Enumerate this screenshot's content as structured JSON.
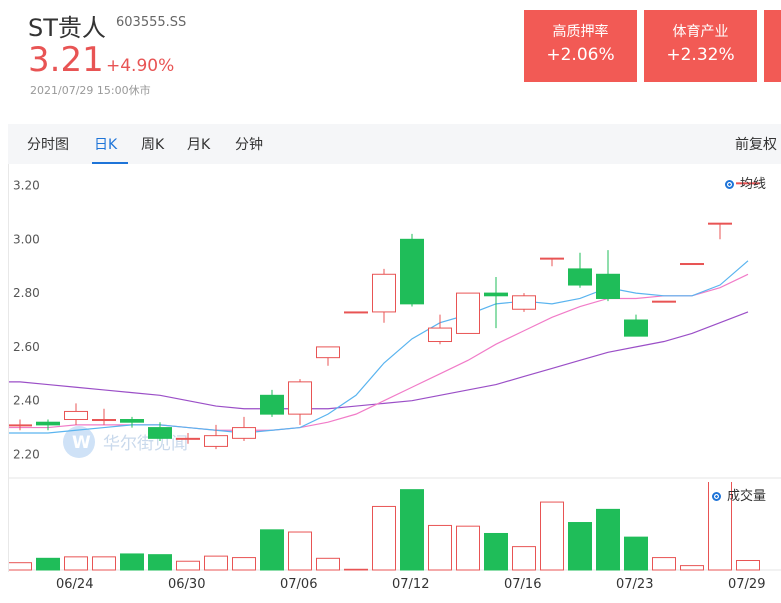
{
  "stock": {
    "name": "ST贵人",
    "code": "603555.SS",
    "price": "3.21",
    "change_pct": "+4.90%",
    "datetime": "2021/07/29 15:00休市"
  },
  "sector_cards": [
    {
      "title": "高质押率",
      "value": "+2.06%"
    },
    {
      "title": "体育产业",
      "value": "+2.32%"
    }
  ],
  "tabs": [
    {
      "label": "分时图"
    },
    {
      "label": "日K"
    },
    {
      "label": "周K"
    },
    {
      "label": "月K"
    },
    {
      "label": "分钟"
    }
  ],
  "active_tab": "日K",
  "adjust_label": "前复权",
  "legend": {
    "ma": "均线",
    "volume": "成交量"
  },
  "watermark": "华尔街见闻",
  "colors": {
    "up": "#e85454",
    "down": "#1fbd59",
    "ma5": "#5ab4ef",
    "ma10": "#f17cc8",
    "ma20": "#9b4fc7"
  },
  "chart_data": {
    "type": "candlestick",
    "y_ticks": [
      "3.20",
      "3.00",
      "2.80",
      "2.60",
      "2.40",
      "2.20"
    ],
    "ylim": [
      2.12,
      3.28
    ],
    "x_ticks": [
      {
        "index": 2,
        "label": "06/24"
      },
      {
        "index": 6,
        "label": "06/30"
      },
      {
        "index": 10,
        "label": "07/06"
      },
      {
        "index": 14,
        "label": "07/12"
      },
      {
        "index": 18,
        "label": "07/16"
      },
      {
        "index": 22,
        "label": "07/23"
      },
      {
        "index": 26,
        "label": "07/29"
      }
    ],
    "candles": [
      {
        "o": 2.31,
        "c": 2.31,
        "h": 2.33,
        "l": 2.29
      },
      {
        "o": 2.32,
        "c": 2.31,
        "h": 2.33,
        "l": 2.29
      },
      {
        "o": 2.33,
        "c": 2.36,
        "h": 2.39,
        "l": 2.31
      },
      {
        "o": 2.33,
        "c": 2.33,
        "h": 2.37,
        "l": 2.31
      },
      {
        "o": 2.33,
        "c": 2.32,
        "h": 2.34,
        "l": 2.3
      },
      {
        "o": 2.3,
        "c": 2.26,
        "h": 2.32,
        "l": 2.25
      },
      {
        "o": 2.26,
        "c": 2.26,
        "h": 2.28,
        "l": 2.24
      },
      {
        "o": 2.23,
        "c": 2.27,
        "h": 2.31,
        "l": 2.22
      },
      {
        "o": 2.26,
        "c": 2.3,
        "h": 2.34,
        "l": 2.25
      },
      {
        "o": 2.42,
        "c": 2.35,
        "h": 2.44,
        "l": 2.34
      },
      {
        "o": 2.35,
        "c": 2.47,
        "h": 2.48,
        "l": 2.31
      },
      {
        "o": 2.56,
        "c": 2.6,
        "h": 2.6,
        "l": 2.53
      },
      {
        "o": 2.73,
        "c": 2.73,
        "h": 2.73,
        "l": 2.73
      },
      {
        "o": 2.73,
        "c": 2.87,
        "h": 2.89,
        "l": 2.69
      },
      {
        "o": 3.0,
        "c": 2.76,
        "h": 3.02,
        "l": 2.75
      },
      {
        "o": 2.62,
        "c": 2.67,
        "h": 2.72,
        "l": 2.61
      },
      {
        "o": 2.65,
        "c": 2.8,
        "h": 2.8,
        "l": 2.65
      },
      {
        "o": 2.8,
        "c": 2.79,
        "h": 2.86,
        "l": 2.67
      },
      {
        "o": 2.74,
        "c": 2.79,
        "h": 2.8,
        "l": 2.73
      },
      {
        "o": 2.93,
        "c": 2.93,
        "h": 2.93,
        "l": 2.9
      },
      {
        "o": 2.89,
        "c": 2.83,
        "h": 2.95,
        "l": 2.82
      },
      {
        "o": 2.87,
        "c": 2.78,
        "h": 2.96,
        "l": 2.77
      },
      {
        "o": 2.7,
        "c": 2.64,
        "h": 2.72,
        "l": 2.64
      },
      {
        "o": 2.77,
        "c": 2.77,
        "h": 2.77,
        "l": 2.77
      },
      {
        "o": 2.91,
        "c": 2.91,
        "h": 2.91,
        "l": 2.91
      },
      {
        "o": 3.06,
        "c": 3.06,
        "h": 3.06,
        "l": 3.0
      },
      {
        "o": 3.21,
        "c": 3.21,
        "h": 3.21,
        "l": 3.21
      }
    ],
    "ma5": [
      2.28,
      2.28,
      2.29,
      2.3,
      2.31,
      2.31,
      2.3,
      2.29,
      2.28,
      2.29,
      2.3,
      2.35,
      2.42,
      2.54,
      2.63,
      2.69,
      2.72,
      2.76,
      2.77,
      2.76,
      2.78,
      2.82,
      2.8,
      2.79,
      2.79,
      2.83,
      2.92
    ],
    "ma10": [
      2.3,
      2.3,
      2.31,
      2.31,
      2.31,
      2.31,
      2.3,
      2.29,
      2.29,
      2.29,
      2.3,
      2.32,
      2.35,
      2.4,
      2.45,
      2.5,
      2.55,
      2.61,
      2.66,
      2.71,
      2.75,
      2.78,
      2.78,
      2.79,
      2.79,
      2.82,
      2.87
    ],
    "ma20": [
      2.47,
      2.46,
      2.45,
      2.44,
      2.43,
      2.42,
      2.4,
      2.38,
      2.37,
      2.37,
      2.37,
      2.37,
      2.38,
      2.39,
      2.4,
      2.42,
      2.44,
      2.46,
      2.49,
      2.52,
      2.55,
      2.58,
      2.6,
      2.62,
      2.65,
      2.69,
      2.73
    ],
    "volumes": [
      0.1,
      0.16,
      0.18,
      0.18,
      0.22,
      0.21,
      0.12,
      0.19,
      0.17,
      0.55,
      0.52,
      0.16,
      0.01,
      0.87,
      1.1,
      0.61,
      0.6,
      0.5,
      0.32,
      0.93,
      0.65,
      0.83,
      0.45,
      0.17,
      0.06,
      2.0,
      0.13
    ]
  }
}
